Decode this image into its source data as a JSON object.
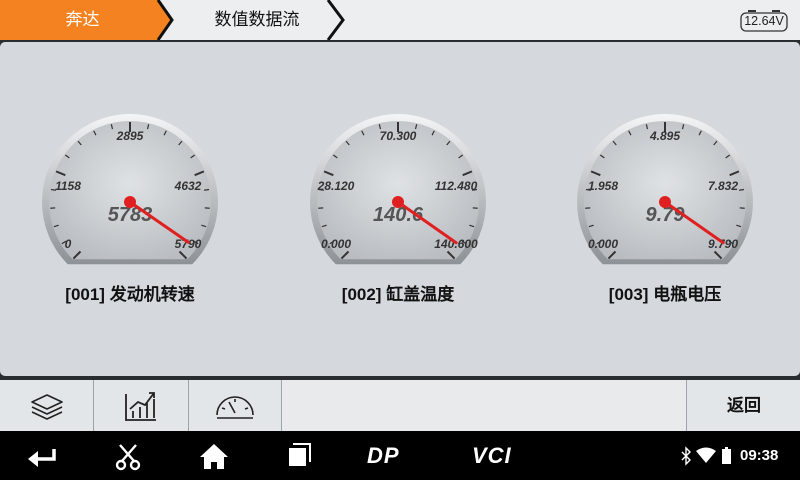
{
  "header": {
    "brand_tab": "奔达",
    "title_tab": "数值数据流",
    "battery_voltage": "12.64V"
  },
  "gauges": [
    {
      "title": "[001] 发动机转速",
      "value_text": "5783",
      "value": 5783,
      "min": 0,
      "max": 5790,
      "ticks": [
        "0",
        "1158",
        "2895",
        "4632",
        "5790"
      ]
    },
    {
      "title": "[002] 缸盖温度",
      "value_text": "140.6",
      "value": 140.6,
      "min": 0,
      "max": 140.6,
      "ticks": [
        "0.000",
        "28.120",
        "70.300",
        "112.480",
        "140.600"
      ]
    },
    {
      "title": "[003] 电瓶电压",
      "value_text": "9.79",
      "value": 9.79,
      "min": 0,
      "max": 9.79,
      "ticks": [
        "0.000",
        "1.958",
        "4.895",
        "7.832",
        "9.790"
      ]
    }
  ],
  "toolbar": {
    "back_label": "返回"
  },
  "navbar": {
    "dp_label": "DP",
    "vci_label": "VCI",
    "time": "09:38"
  },
  "colors": {
    "tab_active": "#f58220",
    "needle": "#e02020",
    "content_bg": "#d5d9dd"
  }
}
